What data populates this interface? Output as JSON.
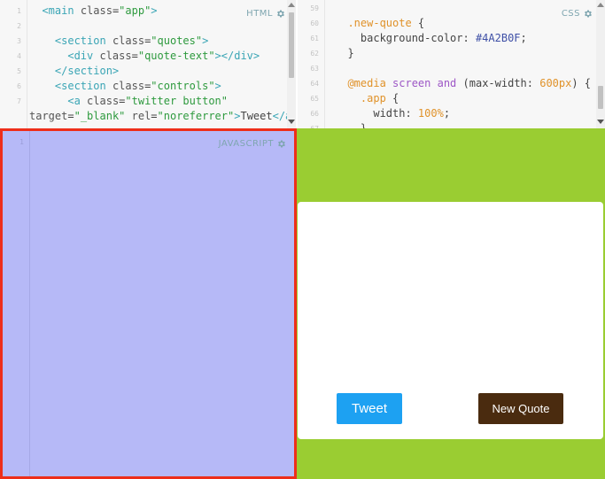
{
  "html_panel": {
    "label": "HTML",
    "line_numbers": [
      "1",
      "2",
      "3",
      "4",
      "5",
      "6",
      "7"
    ],
    "lines": [
      [
        {
          "t": "  ",
          "k": "text"
        },
        {
          "t": "<main ",
          "k": "tag"
        },
        {
          "t": "class",
          "k": "attr"
        },
        {
          "t": "=",
          "k": "text"
        },
        {
          "t": "\"app\"",
          "k": "str"
        },
        {
          "t": ">",
          "k": "tag"
        }
      ],
      [],
      [
        {
          "t": "    ",
          "k": "text"
        },
        {
          "t": "<section ",
          "k": "tag"
        },
        {
          "t": "class",
          "k": "attr"
        },
        {
          "t": "=",
          "k": "text"
        },
        {
          "t": "\"quotes\"",
          "k": "str"
        },
        {
          "t": ">",
          "k": "tag"
        }
      ],
      [
        {
          "t": "      ",
          "k": "text"
        },
        {
          "t": "<div ",
          "k": "tag"
        },
        {
          "t": "class",
          "k": "attr"
        },
        {
          "t": "=",
          "k": "text"
        },
        {
          "t": "\"quote-text\"",
          "k": "str"
        },
        {
          "t": "></div>",
          "k": "tag"
        }
      ],
      [
        {
          "t": "    ",
          "k": "text"
        },
        {
          "t": "</section>",
          "k": "tag"
        }
      ],
      [
        {
          "t": "    ",
          "k": "text"
        },
        {
          "t": "<section ",
          "k": "tag"
        },
        {
          "t": "class",
          "k": "attr"
        },
        {
          "t": "=",
          "k": "text"
        },
        {
          "t": "\"controls\"",
          "k": "str"
        },
        {
          "t": ">",
          "k": "tag"
        }
      ],
      [
        {
          "t": "      ",
          "k": "text"
        },
        {
          "t": "<a ",
          "k": "tag"
        },
        {
          "t": "class",
          "k": "attr"
        },
        {
          "t": "=",
          "k": "text"
        },
        {
          "t": "\"twitter button\"",
          "k": "str"
        }
      ],
      [
        {
          "t": "target",
          "k": "attr"
        },
        {
          "t": "=",
          "k": "text"
        },
        {
          "t": "\"_blank\"",
          "k": "str"
        },
        {
          "t": " rel",
          "k": "attr"
        },
        {
          "t": "=",
          "k": "text"
        },
        {
          "t": "\"noreferrer\"",
          "k": "str"
        },
        {
          "t": ">",
          "k": "tag"
        },
        {
          "t": "Tweet",
          "k": "text"
        },
        {
          "t": "</a>",
          "k": "tag"
        }
      ]
    ]
  },
  "css_panel": {
    "label": "CSS",
    "line_numbers": [
      "59",
      "60",
      "61",
      "62",
      "63",
      "64",
      "65",
      "66",
      "67"
    ],
    "lines": [
      [],
      [
        {
          "t": "  .new-quote ",
          "k": "sel"
        },
        {
          "t": "{",
          "k": "punc"
        }
      ],
      [
        {
          "t": "    background-color: ",
          "k": "prop"
        },
        {
          "t": "#4A2B0F",
          "k": "hex"
        },
        {
          "t": ";",
          "k": "punc"
        }
      ],
      [
        {
          "t": "  }",
          "k": "punc"
        }
      ],
      [],
      [
        {
          "t": "  @media ",
          "k": "at"
        },
        {
          "t": "screen ",
          "k": "kw"
        },
        {
          "t": "and ",
          "k": "kw"
        },
        {
          "t": "(max-width: ",
          "k": "prop"
        },
        {
          "t": "600px",
          "k": "num"
        },
        {
          "t": ") {",
          "k": "punc"
        }
      ],
      [
        {
          "t": "    .app ",
          "k": "sel"
        },
        {
          "t": "{",
          "k": "punc"
        }
      ],
      [
        {
          "t": "      width: ",
          "k": "prop"
        },
        {
          "t": "100%",
          "k": "num"
        },
        {
          "t": ";",
          "k": "punc"
        }
      ],
      [
        {
          "t": "    }",
          "k": "punc"
        }
      ]
    ]
  },
  "js_panel": {
    "label": "JAVASCRIPT",
    "line_numbers": [
      "1"
    ]
  },
  "preview": {
    "tweet_label": "Tweet",
    "new_quote_label": "New Quote"
  },
  "icons": {
    "settings": "gear-icon"
  },
  "colors": {
    "preview_background": "#9acd32",
    "tweet_button": "#1da1f2",
    "new_quote_button": "#4a2b0f",
    "js_highlight_fill": "#b6b9f7",
    "js_highlight_border": "#ee2e1a"
  }
}
